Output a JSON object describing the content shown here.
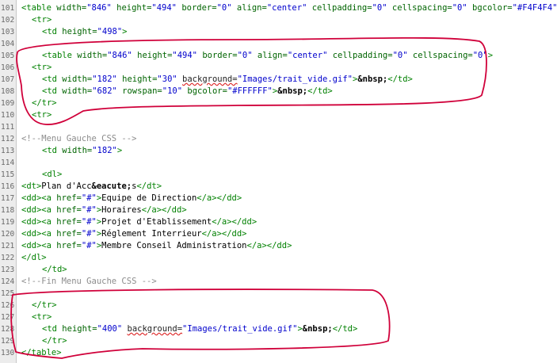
{
  "lines": [
    {
      "n": "101",
      "indent": 0,
      "tokens": [
        [
          "tag",
          "<table "
        ],
        [
          "attr",
          "width="
        ],
        [
          "str",
          "\"846\""
        ],
        [
          "attr",
          " height="
        ],
        [
          "str",
          "\"494\""
        ],
        [
          "attr",
          " border="
        ],
        [
          "str",
          "\"0\""
        ],
        [
          "attr",
          " align="
        ],
        [
          "str",
          "\"center\""
        ],
        [
          "attr",
          " cellpadding="
        ],
        [
          "str",
          "\"0\""
        ],
        [
          "attr",
          " cellspacing="
        ],
        [
          "str",
          "\"0\""
        ],
        [
          "attr",
          " bgcolor="
        ],
        [
          "str",
          "\"#F4F4F4\""
        ],
        [
          "tag",
          ">"
        ]
      ]
    },
    {
      "n": "102",
      "indent": 1,
      "tokens": [
        [
          "tag",
          "<tr>"
        ]
      ]
    },
    {
      "n": "103",
      "indent": 2,
      "tokens": [
        [
          "tag",
          "<td "
        ],
        [
          "attr",
          "height="
        ],
        [
          "str",
          "\"498\""
        ],
        [
          "tag",
          ">"
        ]
      ]
    },
    {
      "n": "104",
      "indent": 0,
      "tokens": []
    },
    {
      "n": "105",
      "indent": 2,
      "tokens": [
        [
          "tag",
          "<table "
        ],
        [
          "attr",
          "width="
        ],
        [
          "str",
          "\"846\""
        ],
        [
          "attr",
          " height="
        ],
        [
          "str",
          "\"494\""
        ],
        [
          "attr",
          " border="
        ],
        [
          "str",
          "\"0\""
        ],
        [
          "attr",
          " align="
        ],
        [
          "str",
          "\"center\""
        ],
        [
          "attr",
          " cellpadding="
        ],
        [
          "str",
          "\"0\""
        ],
        [
          "attr",
          " cellspacing="
        ],
        [
          "str",
          "\"0\""
        ],
        [
          "tag",
          ">"
        ]
      ]
    },
    {
      "n": "106",
      "indent": 1,
      "tokens": [
        [
          "tag",
          "<tr>"
        ]
      ]
    },
    {
      "n": "107",
      "indent": 2,
      "tokens": [
        [
          "tag",
          "<td "
        ],
        [
          "attr",
          "width="
        ],
        [
          "str",
          "\"182\""
        ],
        [
          "attr",
          " height="
        ],
        [
          "str",
          "\"30\" "
        ],
        [
          "bg",
          "background="
        ],
        [
          "str",
          "\"Images/trait_vide.gif\""
        ],
        [
          "tag",
          ">"
        ],
        [
          "ent",
          "&nbsp;"
        ],
        [
          "tag",
          "</td>"
        ]
      ]
    },
    {
      "n": "108",
      "indent": 2,
      "tokens": [
        [
          "tag",
          "<td "
        ],
        [
          "attr",
          "width="
        ],
        [
          "str",
          "\"682\""
        ],
        [
          "attr",
          " rowspan="
        ],
        [
          "str",
          "\"10\""
        ],
        [
          "attr",
          " bgcolor="
        ],
        [
          "str",
          "\"#FFFFFF\""
        ],
        [
          "tag",
          ">"
        ],
        [
          "ent",
          "&nbsp;"
        ],
        [
          "tag",
          "</td>"
        ]
      ]
    },
    {
      "n": "109",
      "indent": 1,
      "tokens": [
        [
          "tag",
          "</tr>"
        ]
      ]
    },
    {
      "n": "110",
      "indent": 1,
      "tokens": [
        [
          "tag",
          "<tr>"
        ]
      ]
    },
    {
      "n": "111",
      "indent": 0,
      "tokens": []
    },
    {
      "n": "112",
      "indent": 0,
      "tokens": [
        [
          "com",
          "<!--Menu Gauche CSS -->"
        ]
      ]
    },
    {
      "n": "113",
      "indent": 2,
      "tokens": [
        [
          "tag",
          "<td "
        ],
        [
          "attr",
          "width="
        ],
        [
          "str",
          "\"182\""
        ],
        [
          "tag",
          ">"
        ]
      ]
    },
    {
      "n": "114",
      "indent": 0,
      "tokens": []
    },
    {
      "n": "115",
      "indent": 2,
      "tokens": [
        [
          "tag",
          "<dl>"
        ]
      ]
    },
    {
      "n": "116",
      "indent": 0,
      "tokens": [
        [
          "tag",
          "<dt>"
        ],
        [
          "txt",
          "Plan d'Acc"
        ],
        [
          "ent",
          "&eacute;"
        ],
        [
          "txt",
          "s"
        ],
        [
          "tag",
          "</dt>"
        ]
      ]
    },
    {
      "n": "117",
      "indent": 0,
      "tokens": [
        [
          "tag",
          "<dd><a "
        ],
        [
          "attr",
          "href="
        ],
        [
          "str",
          "\"#\""
        ],
        [
          "tag",
          ">"
        ],
        [
          "txt",
          "Equipe de Direction"
        ],
        [
          "tag",
          "</a></dd>"
        ]
      ]
    },
    {
      "n": "118",
      "indent": 0,
      "tokens": [
        [
          "tag",
          "<dd><a "
        ],
        [
          "attr",
          "href="
        ],
        [
          "str",
          "\"#\""
        ],
        [
          "tag",
          ">"
        ],
        [
          "txt",
          "Horaires"
        ],
        [
          "tag",
          "</a></dd>"
        ]
      ]
    },
    {
      "n": "119",
      "indent": 0,
      "tokens": [
        [
          "tag",
          "<dd><a "
        ],
        [
          "attr",
          "href="
        ],
        [
          "str",
          "\"#\""
        ],
        [
          "tag",
          ">"
        ],
        [
          "txt",
          "Projet d'Etablissement"
        ],
        [
          "tag",
          "</a></dd>"
        ]
      ]
    },
    {
      "n": "120",
      "indent": 0,
      "tokens": [
        [
          "tag",
          "<dd><a "
        ],
        [
          "attr",
          "href="
        ],
        [
          "str",
          "\"#\""
        ],
        [
          "tag",
          ">"
        ],
        [
          "txt",
          "Réglement Interrieur"
        ],
        [
          "tag",
          "</a></dd>"
        ]
      ]
    },
    {
      "n": "121",
      "indent": 0,
      "tokens": [
        [
          "tag",
          "<dd><a "
        ],
        [
          "attr",
          "href="
        ],
        [
          "str",
          "\"#\""
        ],
        [
          "tag",
          ">"
        ],
        [
          "txt",
          "Membre Conseil Administration"
        ],
        [
          "tag",
          "</a></dd>"
        ]
      ]
    },
    {
      "n": "122",
      "indent": 0,
      "tokens": [
        [
          "tag",
          "</dl>"
        ]
      ]
    },
    {
      "n": "123",
      "indent": 2,
      "tokens": [
        [
          "tag",
          "</td>"
        ]
      ]
    },
    {
      "n": "124",
      "indent": 0,
      "tokens": [
        [
          "com",
          "<!--Fin Menu Gauche CSS -->"
        ]
      ]
    },
    {
      "n": "125",
      "indent": 0,
      "tokens": []
    },
    {
      "n": "126",
      "indent": 1,
      "tokens": [
        [
          "tag",
          "</tr>"
        ]
      ]
    },
    {
      "n": "127",
      "indent": 1,
      "tokens": [
        [
          "tag",
          "<tr>"
        ]
      ]
    },
    {
      "n": "128",
      "indent": 2,
      "tokens": [
        [
          "tag",
          "<td "
        ],
        [
          "attr",
          "height="
        ],
        [
          "str",
          "\"400\" "
        ],
        [
          "bg",
          "background="
        ],
        [
          "str",
          "\"Images/trait_vide.gif\""
        ],
        [
          "tag",
          ">"
        ],
        [
          "ent",
          "&nbsp;"
        ],
        [
          "tag",
          "</td>"
        ]
      ]
    },
    {
      "n": "129",
      "indent": 2,
      "tokens": [
        [
          "tag",
          "</tr>"
        ]
      ]
    },
    {
      "n": "130",
      "indent": 0,
      "tokens": [
        [
          "tag",
          "</table>"
        ]
      ]
    }
  ],
  "colors": {
    "tag": "#008000",
    "attr_value": "#0000cc",
    "comment": "#8c8c8c",
    "annotation": "#d0003a"
  },
  "annotations": [
    "red-circle-lines-105-110",
    "red-circle-lines-125-130"
  ]
}
